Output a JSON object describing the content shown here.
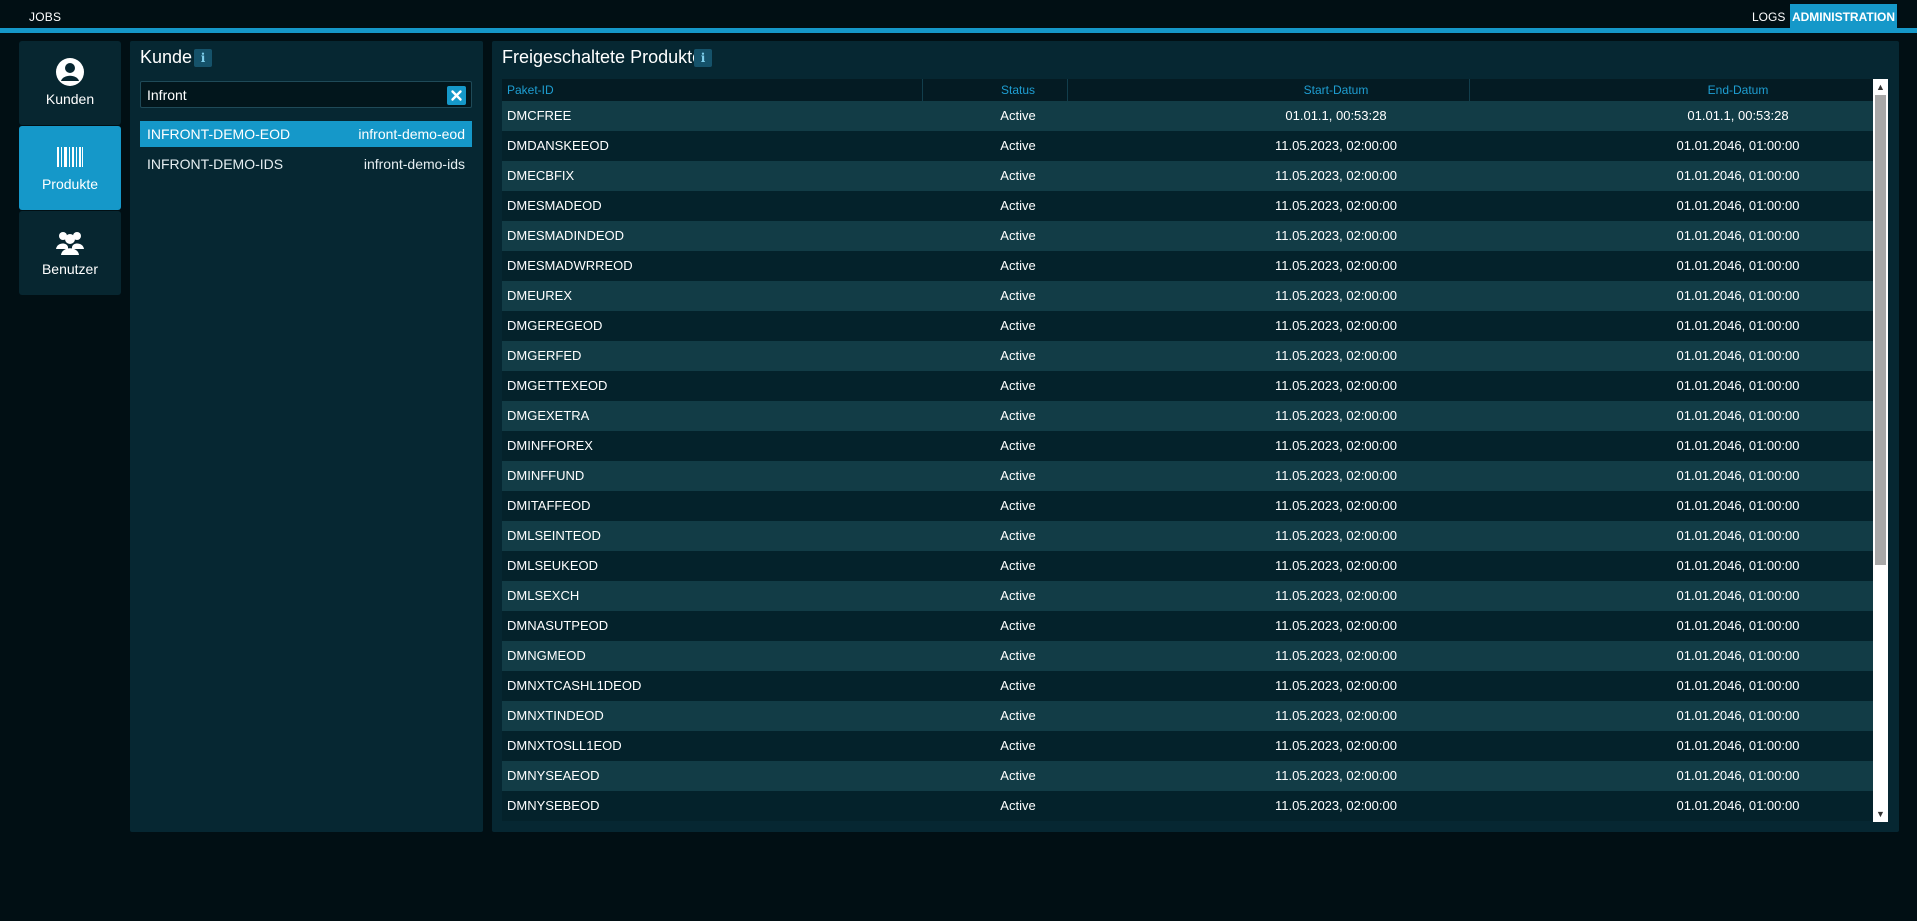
{
  "topnav": {
    "jobs": "JOBS",
    "logs": "LOGS",
    "administration": "ADMINISTRATION"
  },
  "sidenav": {
    "items": [
      {
        "label": "Kunden",
        "icon": "user-circle-icon"
      },
      {
        "label": "Produkte",
        "icon": "barcode-icon"
      },
      {
        "label": "Benutzer",
        "icon": "users-group-icon"
      }
    ],
    "active": "Produkte"
  },
  "customers": {
    "title": "Kunde",
    "info_glyph": "i",
    "search_value": "Infront",
    "rows": [
      {
        "name": "INFRONT-DEMO-EOD",
        "id": "infront-demo-eod",
        "selected": true
      },
      {
        "name": "INFRONT-DEMO-IDS",
        "id": "infront-demo-ids",
        "selected": false
      }
    ]
  },
  "products": {
    "title": "Freigeschaltete Produkte",
    "info_glyph": "i",
    "columns": [
      "Paket-ID",
      "Status",
      "Start-Datum",
      "End-Datum"
    ],
    "rows": [
      {
        "pkg": "DMCFREE",
        "status": "Active",
        "start": "01.01.1, 00:53:28",
        "end": "01.01.1, 00:53:28"
      },
      {
        "pkg": "DMDANSKEEOD",
        "status": "Active",
        "start": "11.05.2023, 02:00:00",
        "end": "01.01.2046, 01:00:00"
      },
      {
        "pkg": "DMECBFIX",
        "status": "Active",
        "start": "11.05.2023, 02:00:00",
        "end": "01.01.2046, 01:00:00"
      },
      {
        "pkg": "DMESMADEOD",
        "status": "Active",
        "start": "11.05.2023, 02:00:00",
        "end": "01.01.2046, 01:00:00"
      },
      {
        "pkg": "DMESMADINDEOD",
        "status": "Active",
        "start": "11.05.2023, 02:00:00",
        "end": "01.01.2046, 01:00:00"
      },
      {
        "pkg": "DMESMADWRREOD",
        "status": "Active",
        "start": "11.05.2023, 02:00:00",
        "end": "01.01.2046, 01:00:00"
      },
      {
        "pkg": "DMEUREX",
        "status": "Active",
        "start": "11.05.2023, 02:00:00",
        "end": "01.01.2046, 01:00:00"
      },
      {
        "pkg": "DMGEREGEOD",
        "status": "Active",
        "start": "11.05.2023, 02:00:00",
        "end": "01.01.2046, 01:00:00"
      },
      {
        "pkg": "DMGERFED",
        "status": "Active",
        "start": "11.05.2023, 02:00:00",
        "end": "01.01.2046, 01:00:00"
      },
      {
        "pkg": "DMGETTEXEOD",
        "status": "Active",
        "start": "11.05.2023, 02:00:00",
        "end": "01.01.2046, 01:00:00"
      },
      {
        "pkg": "DMGEXETRA",
        "status": "Active",
        "start": "11.05.2023, 02:00:00",
        "end": "01.01.2046, 01:00:00"
      },
      {
        "pkg": "DMINFFOREX",
        "status": "Active",
        "start": "11.05.2023, 02:00:00",
        "end": "01.01.2046, 01:00:00"
      },
      {
        "pkg": "DMINFFUND",
        "status": "Active",
        "start": "11.05.2023, 02:00:00",
        "end": "01.01.2046, 01:00:00"
      },
      {
        "pkg": "DMITAFFEOD",
        "status": "Active",
        "start": "11.05.2023, 02:00:00",
        "end": "01.01.2046, 01:00:00"
      },
      {
        "pkg": "DMLSEINTEOD",
        "status": "Active",
        "start": "11.05.2023, 02:00:00",
        "end": "01.01.2046, 01:00:00"
      },
      {
        "pkg": "DMLSEUKEOD",
        "status": "Active",
        "start": "11.05.2023, 02:00:00",
        "end": "01.01.2046, 01:00:00"
      },
      {
        "pkg": "DMLSEXCH",
        "status": "Active",
        "start": "11.05.2023, 02:00:00",
        "end": "01.01.2046, 01:00:00"
      },
      {
        "pkg": "DMNASUTPEOD",
        "status": "Active",
        "start": "11.05.2023, 02:00:00",
        "end": "01.01.2046, 01:00:00"
      },
      {
        "pkg": "DMNGMEOD",
        "status": "Active",
        "start": "11.05.2023, 02:00:00",
        "end": "01.01.2046, 01:00:00"
      },
      {
        "pkg": "DMNXTCASHL1DEOD",
        "status": "Active",
        "start": "11.05.2023, 02:00:00",
        "end": "01.01.2046, 01:00:00"
      },
      {
        "pkg": "DMNXTINDEOD",
        "status": "Active",
        "start": "11.05.2023, 02:00:00",
        "end": "01.01.2046, 01:00:00"
      },
      {
        "pkg": "DMNXTOSLL1EOD",
        "status": "Active",
        "start": "11.05.2023, 02:00:00",
        "end": "01.01.2046, 01:00:00"
      },
      {
        "pkg": "DMNYSEAEOD",
        "status": "Active",
        "start": "11.05.2023, 02:00:00",
        "end": "01.01.2046, 01:00:00"
      },
      {
        "pkg": "DMNYSEBEOD",
        "status": "Active",
        "start": "11.05.2023, 02:00:00",
        "end": "01.01.2046, 01:00:00"
      }
    ]
  },
  "colors": {
    "accent": "#1598c9",
    "background": "#010f14",
    "panel": "#062732",
    "header_text": "#1e9ed2"
  }
}
